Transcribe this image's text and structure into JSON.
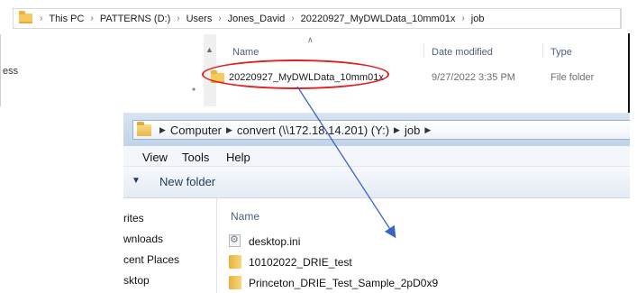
{
  "top_window": {
    "address": {
      "segments": [
        "This PC",
        "PATTERNS (D:)",
        "Users",
        "Jones_David",
        "20220927_MyDWLData_10mm01x",
        "job"
      ]
    },
    "sidebar_fragment": "ess",
    "columns": {
      "name": "Name",
      "date": "Date modified",
      "type": "Type"
    },
    "rows": [
      {
        "name": "20220927_MyDWLData_10mm01x",
        "date": "9/27/2022 3:35 PM",
        "type": "File folder"
      }
    ]
  },
  "bottom_window": {
    "address": {
      "segments": [
        "Computer",
        "convert (\\\\172.18.14.201) (Y:)",
        "job"
      ]
    },
    "menu": [
      "View",
      "Tools",
      "Help"
    ],
    "toolbar": {
      "new_folder": "New folder"
    },
    "nav_items": [
      "rites",
      "wnloads",
      "cent Places",
      "sktop"
    ],
    "column_name": "Name",
    "files": [
      {
        "name": "desktop.ini",
        "icon": "settings-file-icon"
      },
      {
        "name": "10102022_DRIE_test",
        "icon": "folder-icon"
      },
      {
        "name": "Princeton_DRIE_Test_Sample_2pD0x9",
        "icon": "folder-icon"
      }
    ]
  },
  "annotation": {
    "ellipse_color": "#e02020",
    "arrow_color": "#3a63c8"
  }
}
